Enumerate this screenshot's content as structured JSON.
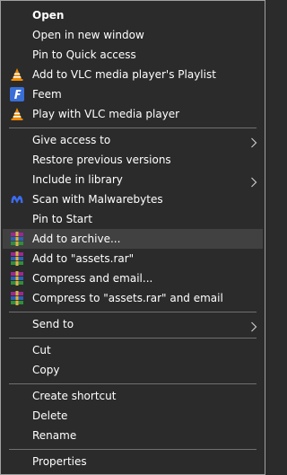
{
  "menu": {
    "items": [
      {
        "label": "Open"
      },
      {
        "label": "Open in new window"
      },
      {
        "label": "Pin to Quick access"
      },
      {
        "label": "Add to VLC media player's Playlist",
        "icon": "vlc-icon"
      },
      {
        "label": "Feem",
        "icon": "feem-icon"
      },
      {
        "label": "Play with VLC media player",
        "icon": "vlc-icon"
      },
      {
        "label": "Give access to"
      },
      {
        "label": "Restore previous versions"
      },
      {
        "label": "Include in library"
      },
      {
        "label": "Scan with Malwarebytes",
        "icon": "malwarebytes-icon"
      },
      {
        "label": "Pin to Start"
      },
      {
        "label": "Add to archive...",
        "icon": "winrar-icon"
      },
      {
        "label": "Add to \"assets.rar\"",
        "icon": "winrar-icon"
      },
      {
        "label": "Compress and email...",
        "icon": "winrar-icon"
      },
      {
        "label": "Compress to \"assets.rar\" and email",
        "icon": "winrar-icon"
      },
      {
        "label": "Send to"
      },
      {
        "label": "Cut"
      },
      {
        "label": "Copy"
      },
      {
        "label": "Create shortcut"
      },
      {
        "label": "Delete"
      },
      {
        "label": "Rename"
      },
      {
        "label": "Properties"
      }
    ],
    "highlighted_item": "Add to archive..."
  },
  "colors": {
    "background": "#2b2b2b",
    "hover": "#414141",
    "text": "#ffffff",
    "separator": "#707070",
    "border": "#a0a0a0"
  }
}
